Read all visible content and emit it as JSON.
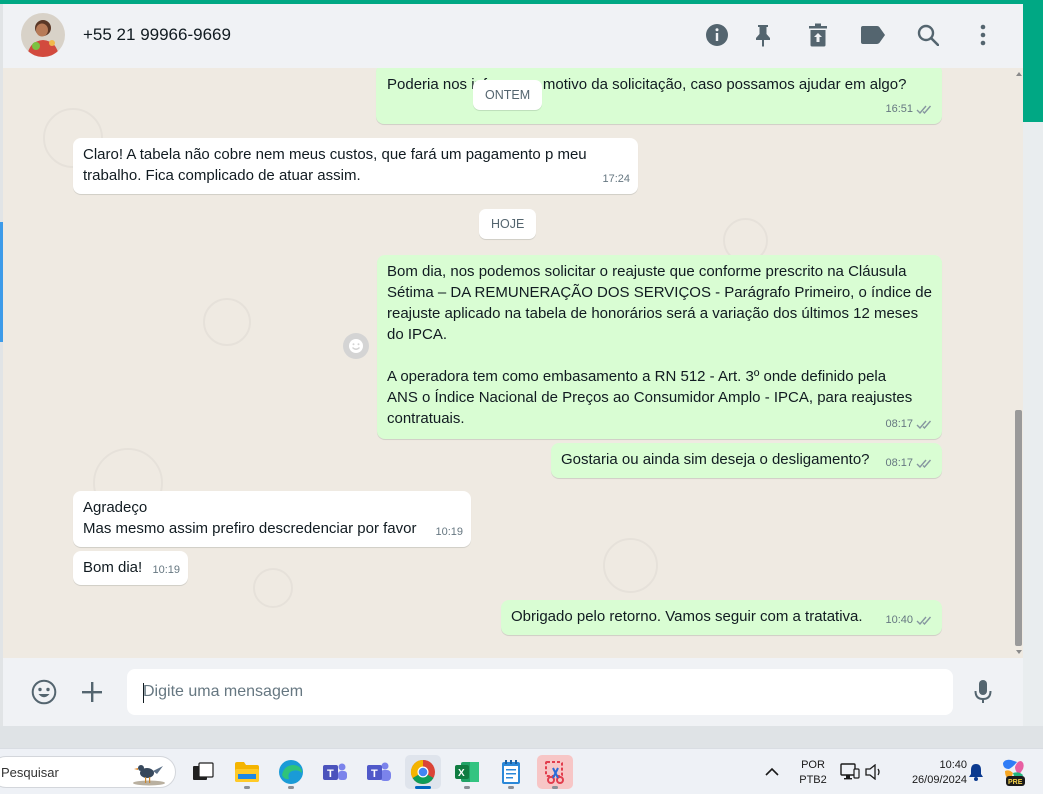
{
  "header": {
    "contact_name": "+55 21 99966-9669",
    "icons": [
      "info-icon",
      "pin-icon",
      "delete-icon",
      "label-icon",
      "search-icon",
      "menu-icon"
    ]
  },
  "date_chips": {
    "yesterday": "ONTEM",
    "today": "HOJE"
  },
  "messages": [
    {
      "direction": "out",
      "text": "Poderia nos informar o motivo da solicitação, caso possamos ajudar em algo?",
      "time": "16:51",
      "status": "read"
    },
    {
      "direction": "in",
      "text": "Claro! A tabela não cobre nem meus custos, que fará um pagamento p meu\ntrabalho. Fica complicado de atuar assim.",
      "time": "17:24"
    },
    {
      "direction": "out",
      "text": "Bom dia, nos podemos solicitar o reajuste que conforme prescrito na Cláusula\nSétima – DA REMUNERAÇÃO DOS SERVIÇOS - Parágrafo Primeiro, o índice de\nreajuste aplicado na tabela de honorários será a variação dos últimos 12 meses\ndo IPCA.\n\nA operadora tem como embasamento a RN 512 - Art. 3º onde definido pela\nANS o Índice Nacional de Preços ao Consumidor Amplo - IPCA, para reajustes\ncontratuais.",
      "time": "08:17",
      "status": "read"
    },
    {
      "direction": "out",
      "text": "Gostaria ou ainda sim deseja o desligamento?",
      "time": "08:17",
      "status": "read"
    },
    {
      "direction": "in",
      "text": "Agradeço\nMas mesmo assim prefiro descredenciar por favor",
      "time": "10:19"
    },
    {
      "direction": "in",
      "text": "Bom dia!",
      "time": "10:19"
    },
    {
      "direction": "out",
      "text": "Obrigado pelo retorno. Vamos seguir com a tratativa.",
      "time": "10:40",
      "status": "read"
    }
  ],
  "composer": {
    "placeholder": "Digite uma mensagem",
    "icons": [
      "emoji-icon",
      "attach-plus-icon",
      "microphone-icon"
    ]
  },
  "taskbar": {
    "search_label": "Pesquisar",
    "apps": [
      "file-explorer",
      "edge",
      "teams-work",
      "teams",
      "chrome",
      "excel",
      "notepad",
      "snipping-tool"
    ],
    "active_app": "chrome",
    "language_top": "POR",
    "language_bottom": "PTB2",
    "time": "10:40",
    "date": "26/09/2024",
    "copilot_badge": "PRE"
  },
  "colors": {
    "accent": "#00a884",
    "outgoing_bubble": "#d9fdd3",
    "incoming_bubble": "#ffffff",
    "chat_background": "#efeae2",
    "read_ticks": "#8696a0"
  }
}
